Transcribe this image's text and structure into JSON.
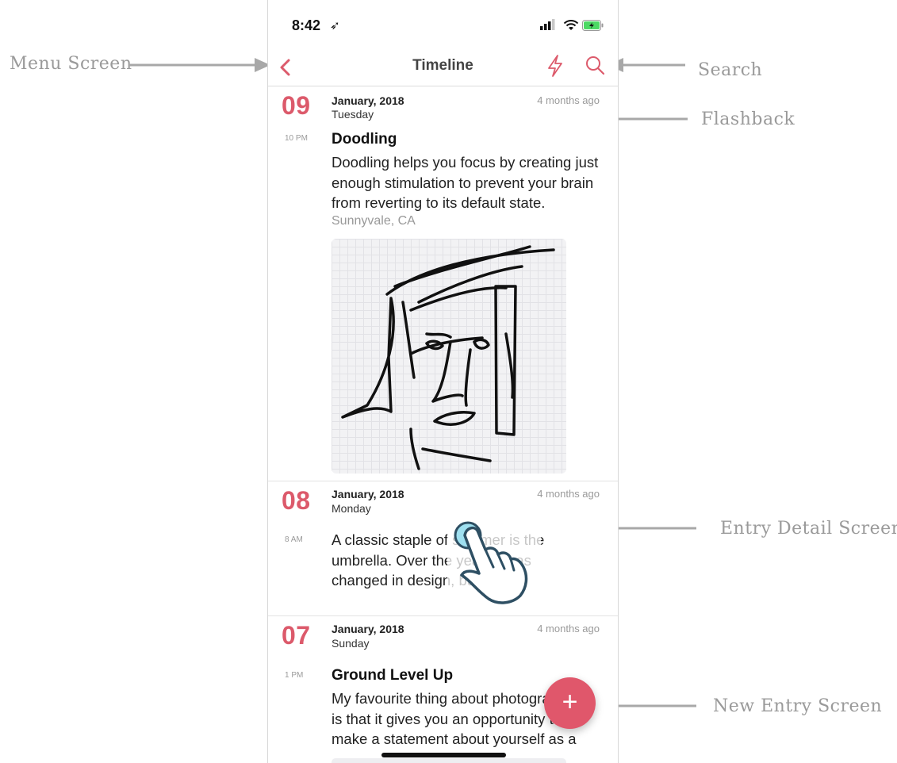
{
  "status_bar": {
    "time": "8:42",
    "location_glyph": "➶"
  },
  "nav": {
    "title": "Timeline",
    "back_icon": "chevron-left-icon",
    "flash_icon": "lightning-icon",
    "search_icon": "search-icon"
  },
  "accent": "#dc5a6b",
  "entries": [
    {
      "day": "09",
      "month": "January, 2018",
      "weekday": "Tuesday",
      "ago": "4 months ago",
      "time": "10 PM",
      "title": "Doodling",
      "body": "Doodling helps you focus by creating just enough stimulation to prevent your brain from reverting to its default state.",
      "place": "Sunnyvale, CA"
    },
    {
      "day": "08",
      "month": "January, 2018",
      "weekday": "Monday",
      "ago": "4 months ago",
      "time": "8 AM",
      "body_lines": [
        "A classic staple of summer is the",
        "umbrella. Over the years it has",
        "changed in design, but the"
      ]
    },
    {
      "day": "07",
      "month": "January, 2018",
      "weekday": "Sunday",
      "ago": "4 months ago",
      "time": "1 PM",
      "title": "Ground Level Up",
      "body_lines": [
        "My favourite thing about photography",
        "is that it gives you an opportunity to",
        "make a statement about yourself as a"
      ]
    }
  ],
  "fab": {
    "label": "+"
  },
  "annotations": {
    "menu": "Menu Screen",
    "search": "Search",
    "flashback": "Flashback",
    "entry_detail": "Entry Detail Screen",
    "new_entry": "New Entry Screen"
  }
}
